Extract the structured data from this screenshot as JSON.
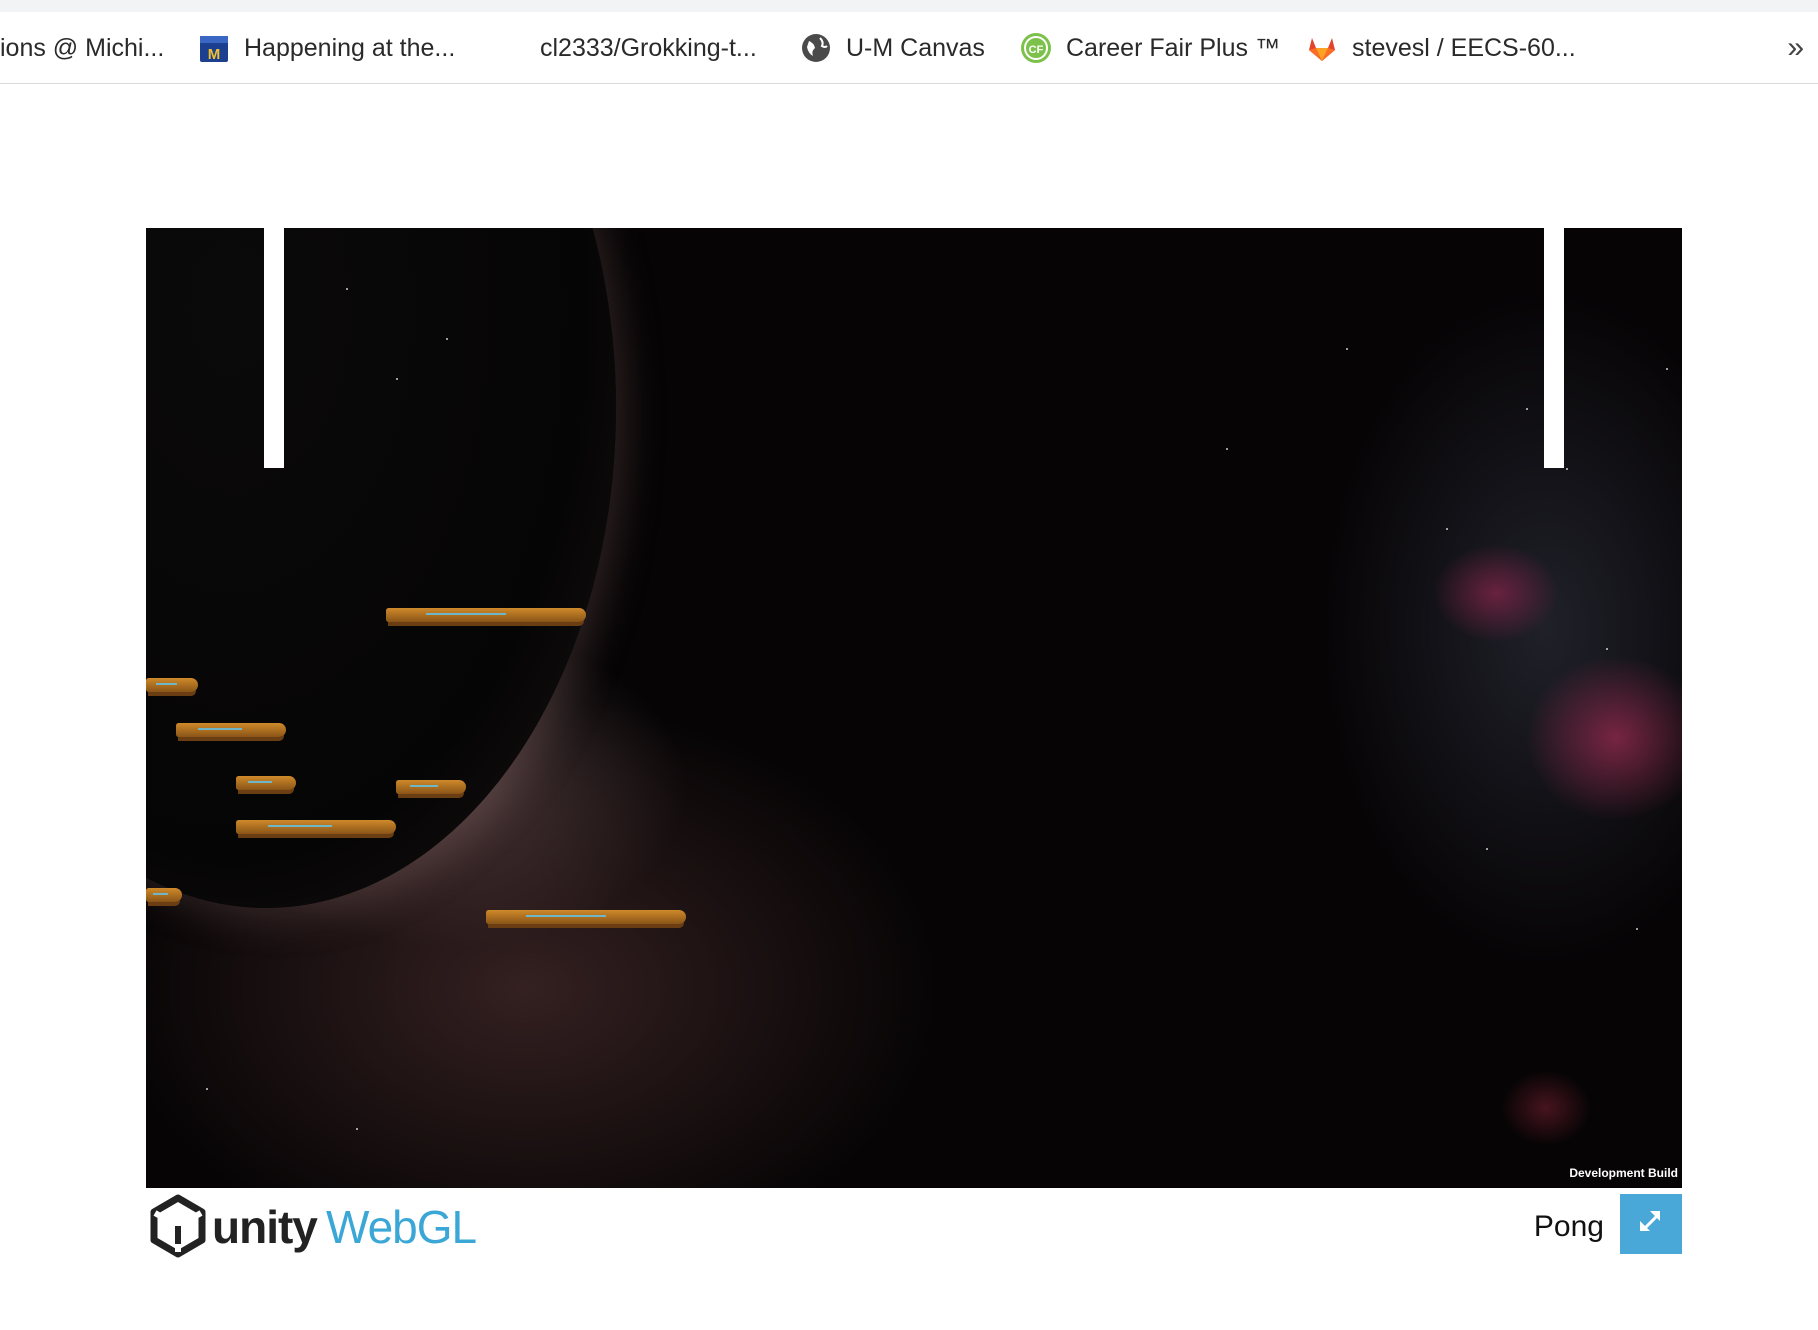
{
  "bookmarks": [
    {
      "label": "ions @ Michi...",
      "icon": "none"
    },
    {
      "label": "Happening at the...",
      "icon": "michigan-calendar-icon"
    },
    {
      "label": "cl2333/Grokking-t...",
      "icon": "none"
    },
    {
      "label": "U-M Canvas",
      "icon": "globe-icon"
    },
    {
      "label": "Career Fair Plus ™",
      "icon": "cf-icon",
      "icon_text": "CF"
    },
    {
      "label": "stevesl / EECS-60...",
      "icon": "gitlab-icon"
    }
  ],
  "more_label": "»",
  "player": {
    "dev_build_label": "Development Build"
  },
  "footer": {
    "unity_text": "unity",
    "webgl_text": "WebGL",
    "title": "Pong",
    "fullscreen_icon": "expand-arrows-icon"
  },
  "colors": {
    "webgl": "#3ba7d6",
    "fullscreen_button": "#4aa8d8",
    "paddle": "#ffffff"
  }
}
